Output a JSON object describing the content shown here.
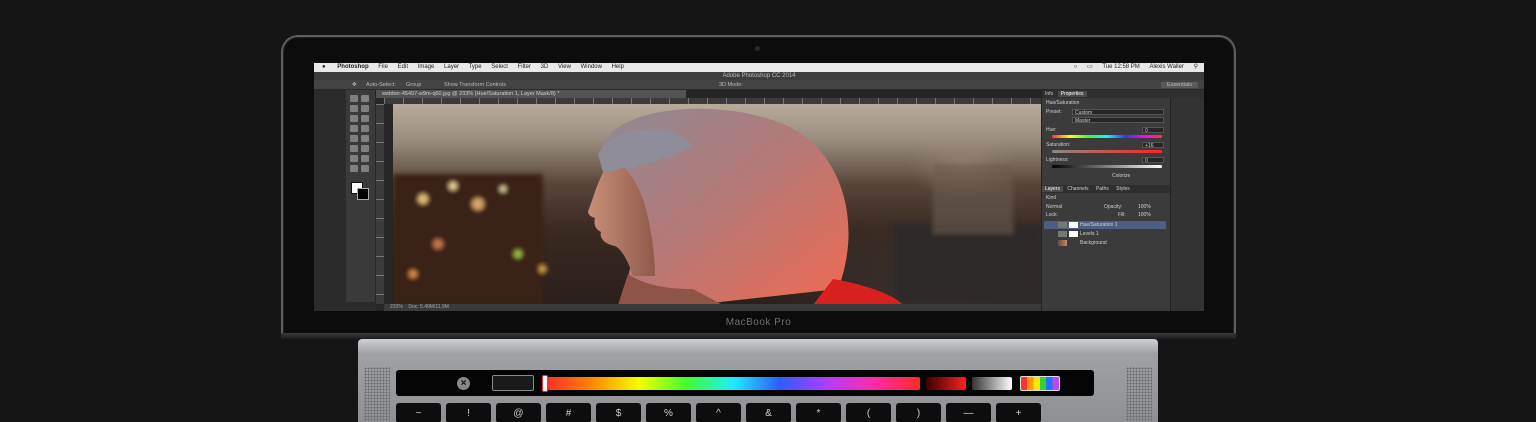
{
  "laptop": {
    "model_label": "MacBook Pro"
  },
  "menubar": {
    "items": [
      "Photoshop",
      "File",
      "Edit",
      "Image",
      "Layer",
      "Type",
      "Select",
      "Filter",
      "3D",
      "View",
      "Window",
      "Help"
    ],
    "clock": "Tue 12:58 PM",
    "user": "Alexis Waller"
  },
  "app": {
    "window_title": "Adobe Photoshop CC 2014",
    "document_tab": "webber-45497-w9m-q60.jpg @ 233% (Hue/Saturation 1, Layer Mask/8) *",
    "workspace_button": "Essentials"
  },
  "options_bar": {
    "auto_select_label": "Auto-Select:",
    "auto_select_value": "Group",
    "transform_label": "Show Transform Controls",
    "mode_label": "3D Mode:"
  },
  "statusbar": {
    "zoom": "233%",
    "doc_info": "Doc: 5.49M/11.9M"
  },
  "properties_panel": {
    "tabs": [
      "Info",
      "Properties"
    ],
    "title": "Hue/Saturation",
    "preset_label": "Preset:",
    "preset_value": "Custom",
    "channel_value": "Master",
    "hue_label": "Hue:",
    "hue_value": "0",
    "saturation_label": "Saturation:",
    "saturation_value": "+16",
    "lightness_label": "Lightness:",
    "lightness_value": "0",
    "colorize_label": "Colorize"
  },
  "layers_panel": {
    "tabs": [
      "Layers",
      "Channels",
      "Paths",
      "Styles"
    ],
    "kind_label": "Kind",
    "blend_mode": "Normal",
    "opacity_label": "Opacity:",
    "opacity_value": "100%",
    "lock_label": "Lock:",
    "fill_label": "Fill:",
    "fill_value": "100%",
    "layers": [
      "Hue/Saturation 1",
      "Levels 1",
      "Background"
    ]
  },
  "touchbar": {
    "esc_symbol": "×",
    "accent_colors": [
      "#ff2a2a",
      "#ff8a00",
      "#f4ff00",
      "#3dff2e",
      "#1eedff",
      "#2e5cff",
      "#b03dff",
      "#ff2aa8"
    ]
  },
  "keyboard": {
    "keys": [
      "~",
      "!",
      "@",
      "#",
      "$",
      "%",
      "^",
      "&",
      "*",
      "(",
      ")",
      "—",
      "+"
    ]
  }
}
